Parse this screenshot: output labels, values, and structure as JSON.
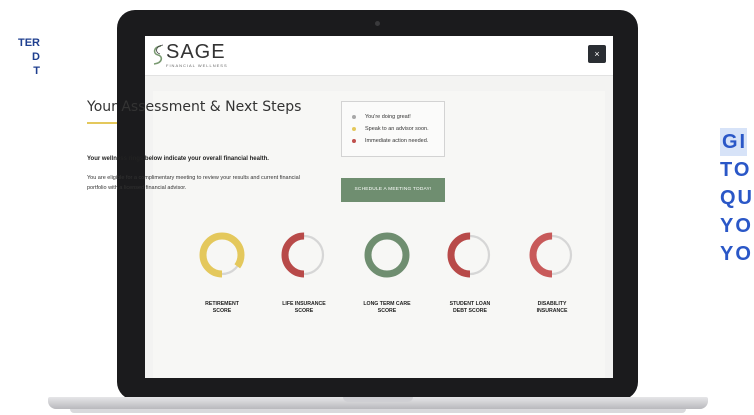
{
  "left_text": [
    "TER",
    "D",
    "T"
  ],
  "right_text": [
    "GI",
    "TO",
    "QU",
    "YO",
    "YO"
  ],
  "app": {
    "brand": "SAGE",
    "tagline": "FINANCIAL WELLNESS",
    "close_label": "×"
  },
  "assessment": {
    "title": "Your Assessment & Next Steps",
    "subhead": "Your wellness rings below indicate your overall financial health.",
    "description": "You are eligible for a complimentary meeting to review your results and current financial portfolio with a licensed financial advisor."
  },
  "legend": {
    "items": [
      {
        "label": "You're doing great!",
        "color": "#a8a8a8"
      },
      {
        "label": "Speak to an advisor soon.",
        "color": "#e4c85c"
      },
      {
        "label": "Immediate action needed.",
        "color": "#c0504d"
      }
    ]
  },
  "cta": {
    "label": "SCHEDULE A MEETING TODAY!"
  },
  "rings": [
    {
      "label_1": "RETIREMENT",
      "label_2": "SCORE",
      "color": "#e4c85c",
      "fill": 0.85
    },
    {
      "label_1": "LIFE INSURANCE",
      "label_2": "SCORE",
      "color": "#b84a49",
      "fill": 0.5
    },
    {
      "label_1": "LONG TERM CARE",
      "label_2": "SCORE",
      "color": "#6f8e70",
      "fill": 1.0
    },
    {
      "label_1": "STUDENT LOAN",
      "label_2": "DEBT SCORE",
      "color": "#b84a49",
      "fill": 0.5
    },
    {
      "label_1": "DISABILITY",
      "label_2": "INSURANCE",
      "color": "#c85a5a",
      "fill": 0.5
    }
  ],
  "colors": {
    "accent_green": "#6f8e70",
    "accent_yellow": "#e4c85c",
    "accent_red": "#b84a49"
  }
}
